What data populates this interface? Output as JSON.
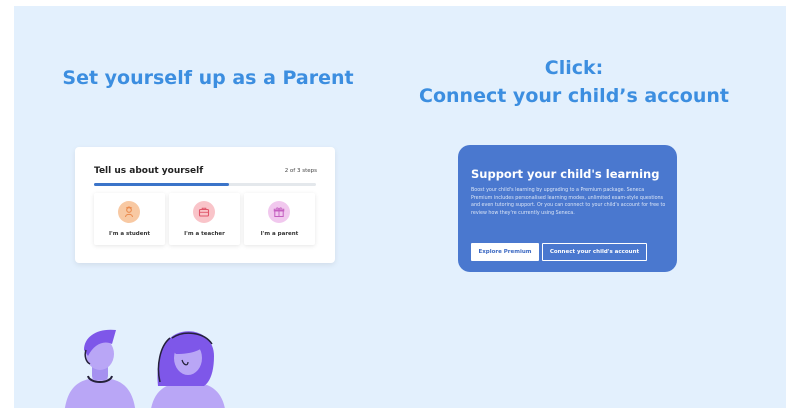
{
  "left": {
    "heading": "Set yourself up as a Parent"
  },
  "right": {
    "heading_line1": "Click:",
    "heading_line2": "Connect your child’s account"
  },
  "onboarding_card": {
    "title": "Tell us about yourself",
    "steps": "2 of 3 steps",
    "progress": 0.61,
    "roles": [
      {
        "label": "I'm a student",
        "icon": "student-icon",
        "color": "#f8c9a3",
        "icon_color": "#ea8a4d"
      },
      {
        "label": "I'm a teacher",
        "icon": "briefcase-icon",
        "color": "#f9c4c9",
        "icon_color": "#e0566a"
      },
      {
        "label": "I'm a parent",
        "icon": "gift-icon",
        "color": "#f1c8ee",
        "icon_color": "#c45fc0"
      }
    ]
  },
  "support_card": {
    "title": "Support your child's learning",
    "body": "Boost your child's learning by upgrading to a Premium package. Seneca Premium includes personalised learning modes, unlimited exam-style questions and even tutoring support. Or you can connect to your child's account for free to review how they're currently using Seneca.",
    "explore_label": "Explore Premium",
    "connect_label": "Connect your child's account",
    "background": "#4a78cf"
  },
  "colors": {
    "heading": "#3c8ee0",
    "background": "#e3f0fd"
  }
}
